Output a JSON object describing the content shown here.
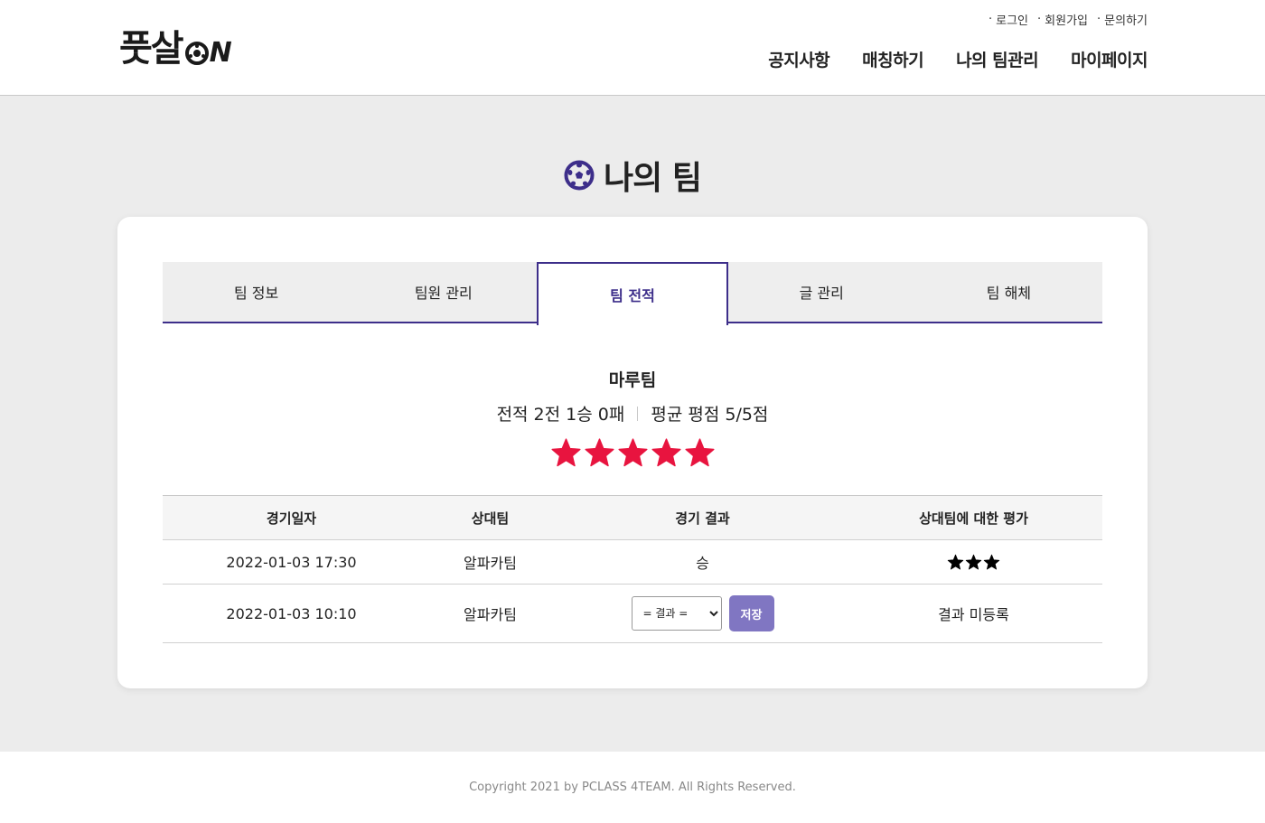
{
  "header": {
    "logo_text": "풋살",
    "logo_on": "N",
    "util_links": [
      "로그인",
      "회원가입",
      "문의하기"
    ],
    "nav": [
      "공지사항",
      "매칭하기",
      "나의 팀관리",
      "마이페이지"
    ]
  },
  "page": {
    "title": "나의 팀"
  },
  "tabs": [
    {
      "label": "팀 정보",
      "active": false
    },
    {
      "label": "팀원 관리",
      "active": false
    },
    {
      "label": "팀 전적",
      "active": true
    },
    {
      "label": "글 관리",
      "active": false
    },
    {
      "label": "팀 해체",
      "active": false
    }
  ],
  "team": {
    "name": "마루팀",
    "record": "전적 2전 1승 0패",
    "average_rating": "평균 평점 5/5점",
    "stars": 5,
    "star_color": "#e8143f"
  },
  "table": {
    "headers": [
      "경기일자",
      "상대팀",
      "경기 결과",
      "상대팀에 대한 평가"
    ],
    "rows": [
      {
        "date": "2022-01-03 17:30",
        "opponent": "알파카팀",
        "result": "승",
        "rating_stars": 3
      },
      {
        "date": "2022-01-03 10:10",
        "opponent": "알파카팀",
        "select_value": "= 결과 =",
        "save_label": "저장",
        "evaluation": "결과 미등록"
      }
    ]
  },
  "footer": {
    "copyright": "Copyright 2021 by PCLASS 4TEAM. All Rights Reserved."
  },
  "colors": {
    "accent": "#3d2e8a",
    "button": "#8076c2"
  }
}
